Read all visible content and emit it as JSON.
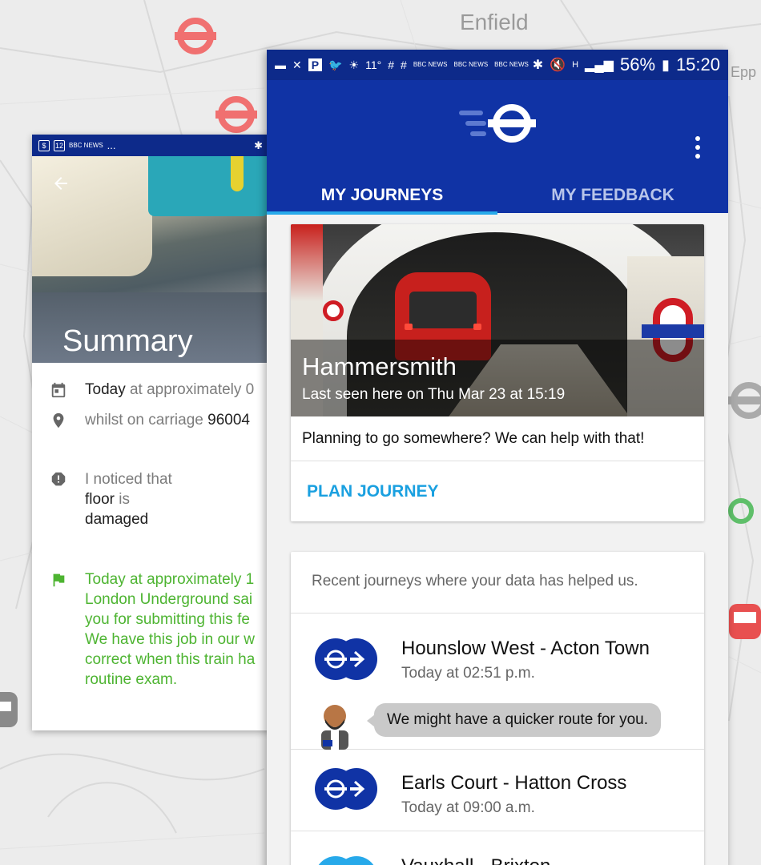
{
  "map": {
    "place_label": "Enfield",
    "place_label_2": "Epp"
  },
  "left_screen": {
    "status_icons": [
      "dollar-icon",
      "calendar-12-icon",
      "bbc-news-icon",
      "more-icon",
      "bluetooth-icon"
    ],
    "status_calendar_number": "12",
    "status_more": "...",
    "title": "Summary",
    "date_bold": "Today",
    "date_rest": " at approximately 0",
    "location_prefix": "whilst on carriage ",
    "location_value": "96004",
    "notice_prefix": "I noticed that",
    "notice_item": "floor",
    "notice_is": " is",
    "notice_state": "damaged",
    "response_lines": [
      "Today at approximately 1",
      "London Underground sai",
      "you for submitting this fe",
      "We have this job in our w",
      "correct when this train ha",
      "routine exam."
    ]
  },
  "right_screen": {
    "status": {
      "weather_temp": "11°",
      "battery": "56%",
      "time": "15:20",
      "bbc_label": "BBC NEWS",
      "signal_h": "H"
    },
    "tabs": [
      {
        "label": "MY JOURNEYS",
        "active": true
      },
      {
        "label": "MY FEEDBACK",
        "active": false
      }
    ],
    "hero": {
      "station": "Hammersmith",
      "last_seen": "Last seen here on Thu Mar 23 at 15:19"
    },
    "plan_prompt": "Planning to go somewhere? We can help with that!",
    "plan_button": "PLAN JOURNEY",
    "recent_heading": "Recent journeys where your data has helped us.",
    "journeys": [
      {
        "route": "Hounslow West - Acton Town",
        "time": "Today at 02:51 p.m.",
        "message": "We might have a quicker route for you."
      },
      {
        "route": "Earls Court - Hatton Cross",
        "time": "Today at 09:00 a.m."
      },
      {
        "route": "Vauxhall - Brixton",
        "time": ""
      }
    ]
  },
  "colors": {
    "header_blue": "#1033a5",
    "status_blue": "#0d2a8a",
    "accent_cyan": "#27a9ea",
    "link_blue": "#1aa0e0",
    "feedback_green": "#4db431",
    "roundel_red": "#cf1c24"
  }
}
